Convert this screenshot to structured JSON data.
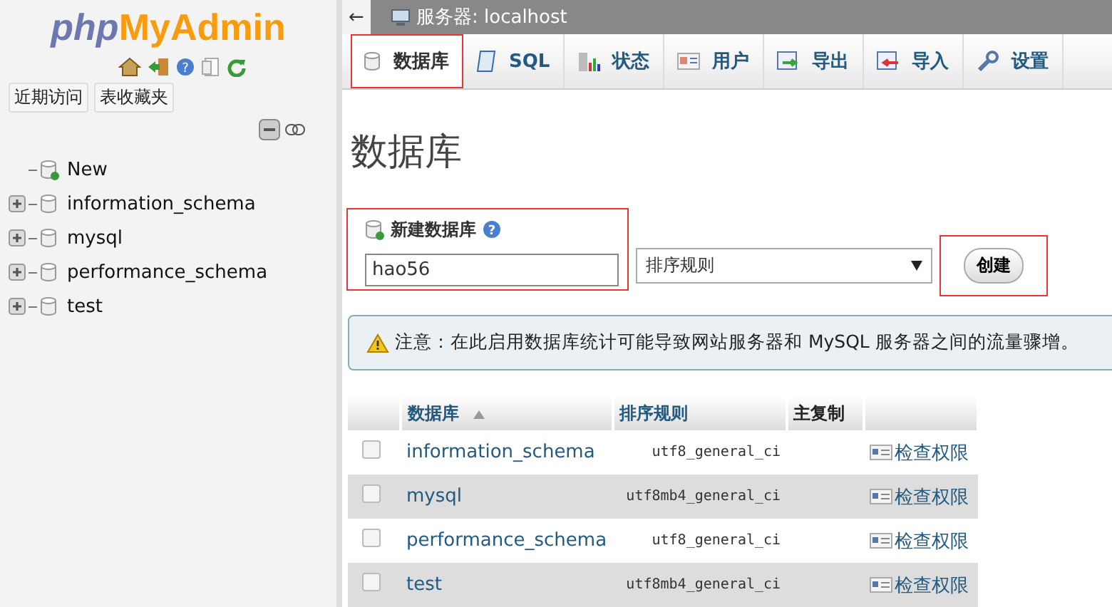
{
  "sidebar": {
    "logo": {
      "part1": "php",
      "part2": "MyAdmin"
    },
    "help_glyph": "?",
    "buttons": [
      "近期访问",
      "表收藏夹"
    ],
    "tree": [
      {
        "label": "New",
        "kind": "new",
        "expandable": false
      },
      {
        "label": "information_schema",
        "kind": "db",
        "expandable": true
      },
      {
        "label": "mysql",
        "kind": "db",
        "expandable": true
      },
      {
        "label": "performance_schema",
        "kind": "db",
        "expandable": true
      },
      {
        "label": "test",
        "kind": "db",
        "expandable": true
      }
    ]
  },
  "topbar": {
    "back": "←",
    "title": "服务器: localhost"
  },
  "tabs": [
    {
      "label": "数据库",
      "kind": "db",
      "selected": true,
      "annotated": true
    },
    {
      "label": "SQL",
      "kind": "sql",
      "selected": false,
      "annotated": false
    },
    {
      "label": "状态",
      "kind": "status",
      "selected": false,
      "annotated": false
    },
    {
      "label": "用户",
      "kind": "user",
      "selected": false,
      "annotated": false
    },
    {
      "label": "导出",
      "kind": "export",
      "selected": false,
      "annotated": false
    },
    {
      "label": "导入",
      "kind": "import",
      "selected": false,
      "annotated": false
    },
    {
      "label": "设置",
      "kind": "settings",
      "selected": false,
      "annotated": false
    }
  ],
  "page_title": "数据库",
  "create": {
    "label": "新建数据库",
    "help_glyph": "?",
    "name_value": "hao56",
    "collation": "排序规则",
    "button": "创建",
    "annotated": true
  },
  "notice": "注意：在此启用数据库统计可能导致网站服务器和 MySQL 服务器之间的流量骤增。",
  "table": {
    "columns": [
      "数据库",
      "排序规则",
      "主复制"
    ],
    "rows": [
      {
        "name": "information_schema",
        "collation": "utf8_general_ci",
        "action": "检查权限",
        "checked": false
      },
      {
        "name": "mysql",
        "collation": "utf8mb4_general_ci",
        "action": "检查权限",
        "checked": false
      },
      {
        "name": "performance_schema",
        "collation": "utf8_general_ci",
        "action": "检查权限",
        "checked": false
      },
      {
        "name": "test",
        "collation": "utf8mb4_general_ci",
        "action": "检查权限",
        "checked": false
      }
    ]
  }
}
